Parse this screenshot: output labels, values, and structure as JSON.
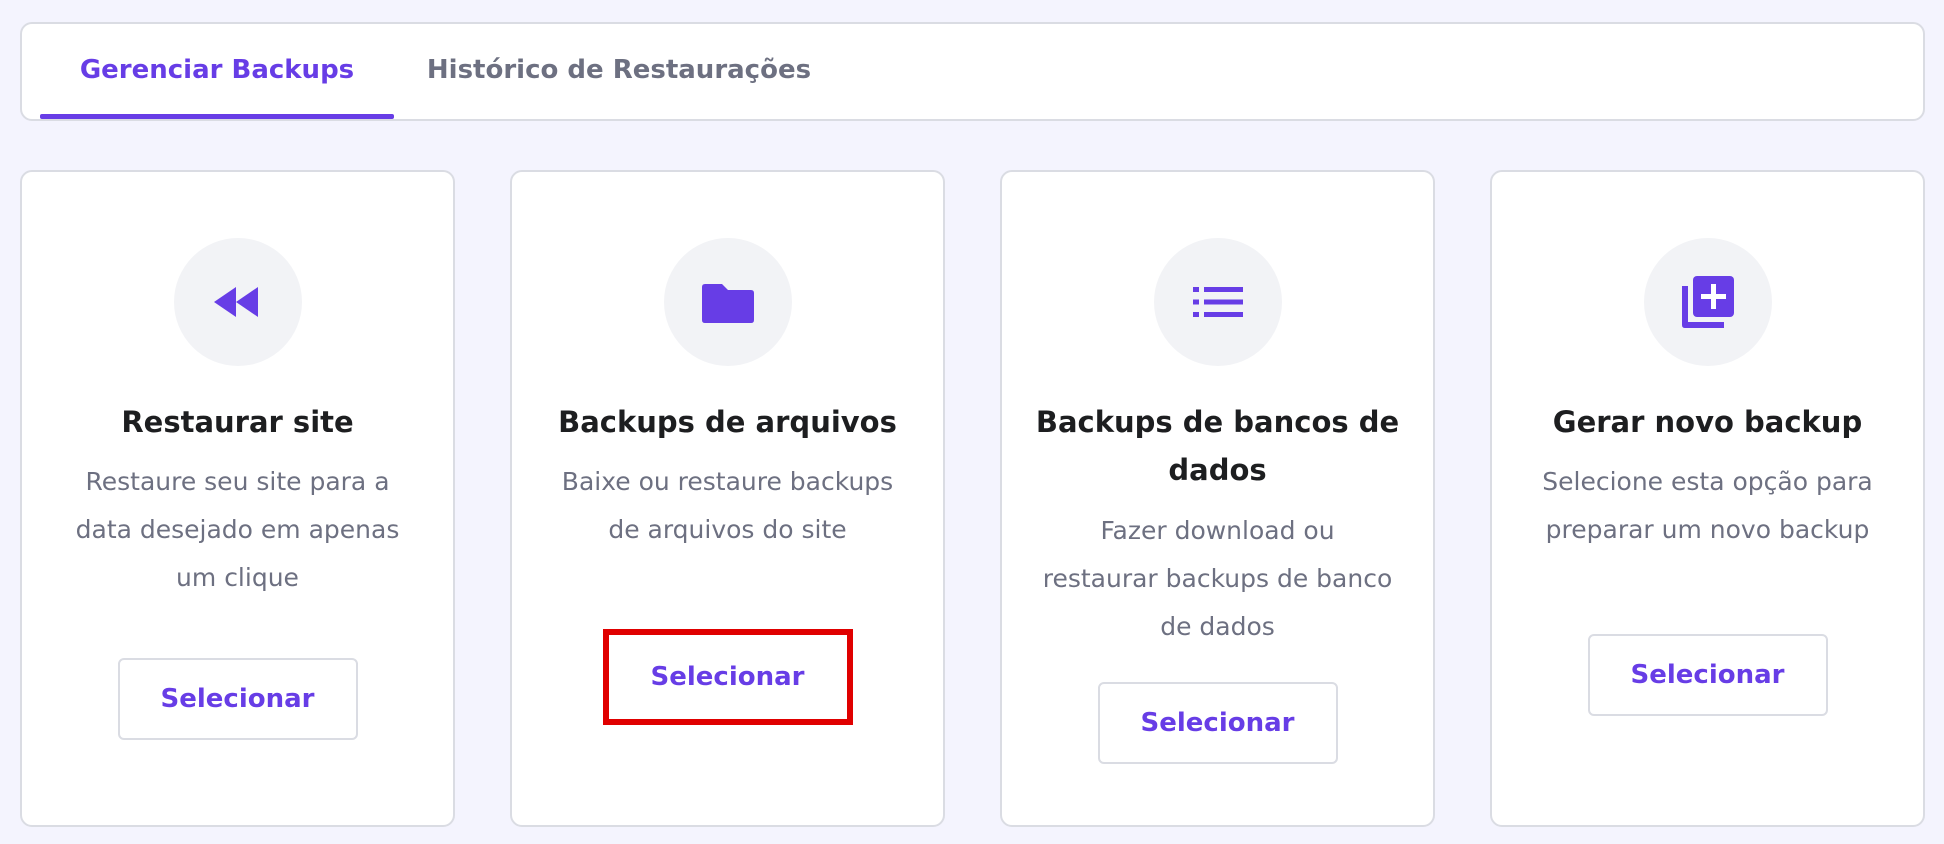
{
  "tabs": [
    {
      "label": "Gerenciar Backups",
      "active": true
    },
    {
      "label": "Histórico de Restaurações",
      "active": false
    }
  ],
  "cards": [
    {
      "icon": "rewind-icon",
      "title": "Restaurar site",
      "description": "Restaure seu site para a data desejado em apenas um clique",
      "button_label": "Selecionar"
    },
    {
      "icon": "folder-icon",
      "title": "Backups de arquivos",
      "description": "Baixe ou restaure backups de arquivos do site",
      "button_label": "Selecionar"
    },
    {
      "icon": "list-icon",
      "title": "Backups de bancos de dados",
      "description": "Fazer download ou restaurar backups de banco de dados",
      "button_label": "Selecionar"
    },
    {
      "icon": "add-copy-icon",
      "title": "Gerar novo backup",
      "description": "Selecione esta opção para preparar um novo backup",
      "button_label": "Selecionar"
    }
  ],
  "colors": {
    "accent": "#673de6",
    "highlight": "#e00000",
    "icon_bg": "#f2f3f6",
    "text_primary": "#1d1e20",
    "text_secondary": "#6d7081",
    "page_bg": "#f4f4fe",
    "border": "#dadce3"
  }
}
